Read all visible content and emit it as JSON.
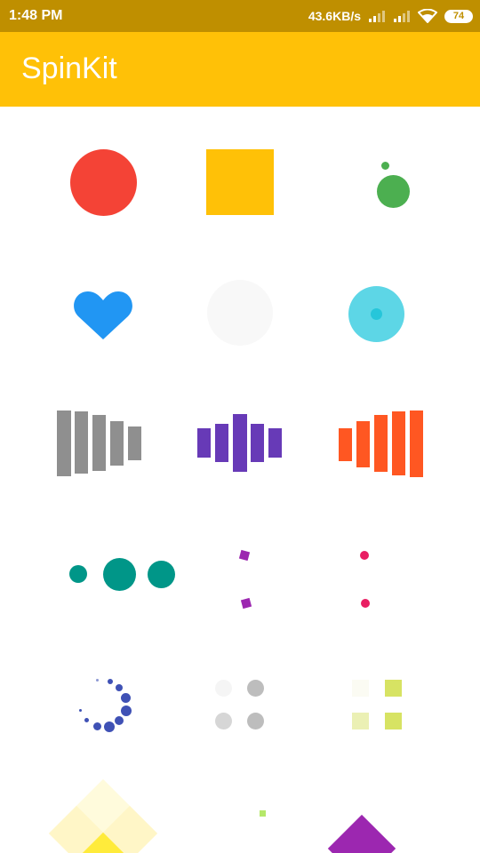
{
  "status_bar": {
    "time": "1:48 PM",
    "net_speed": "43.6KB/s",
    "battery_level": "74",
    "icons": [
      "signal-icon",
      "signal-icon",
      "wifi-icon",
      "battery-icon"
    ]
  },
  "app_bar": {
    "title": "SpinKit"
  },
  "colors": {
    "status_bar": "#bf8f00",
    "app_bar": "#ffc107",
    "red": "#f44336",
    "amber": "#ffc107",
    "green": "#4caf50",
    "blue": "#2196f3",
    "cyan": "#5dd6e6",
    "grey": "#8f8f8f",
    "deep_purple": "#673ab7",
    "deep_orange": "#ff5722",
    "teal": "#009688",
    "purple": "#9c27b0",
    "pink": "#e91e63",
    "indigo": "#3f51b5",
    "lime": "#cddc39",
    "yellow": "#ffeb3b"
  },
  "spinners": [
    "double-bounce-spinner",
    "rotating-plane-spinner",
    "chasing-dots-spinner",
    "pulse-heart-spinner",
    "pulse-spinner",
    "pulsing-ring-spinner",
    "wave-bars-left-spinner",
    "wave-bars-center-spinner",
    "wave-bars-right-spinner",
    "three-bounce-spinner",
    "wandering-cubes-spinner",
    "wandering-dots-spinner",
    "fading-circle-spinner",
    "fading-four-spinner",
    "fading-cube-spinner",
    "folding-cube-spinner",
    "pixel-spinner",
    "rotating-square-spinner"
  ]
}
